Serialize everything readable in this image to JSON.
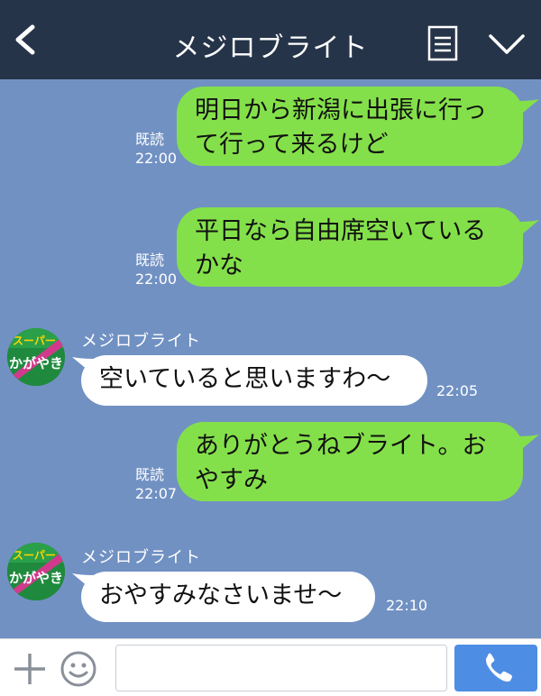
{
  "header": {
    "title": "メジロブライト"
  },
  "messages": [
    {
      "dir": "out",
      "lines": [
        "明日から新潟に出張に行っ",
        "て行って来るけど"
      ],
      "read": "既読",
      "time": "22:00"
    },
    {
      "dir": "out",
      "lines": [
        "平日なら自由席空いている",
        "かな"
      ],
      "read": "既読",
      "time": "22:00"
    },
    {
      "dir": "in",
      "sender": "メジロブライト",
      "lines": [
        "空いていると思いますわ〜"
      ],
      "time": "22:05"
    },
    {
      "dir": "out",
      "lines": [
        "ありがとうねブライト。お",
        "やすみ"
      ],
      "read": "既読",
      "time": "22:07"
    },
    {
      "dir": "in",
      "sender": "メジロブライト",
      "lines": [
        "おやすみなさいませ〜"
      ],
      "time": "22:10"
    }
  ],
  "avatar": {
    "logo_text": "スーパー",
    "name_text": "かがやき"
  },
  "input": {
    "placeholder": ""
  },
  "colors": {
    "header": "#263449",
    "chat_bg": "#7191c3",
    "out_bubble": "#84e04a",
    "in_bubble": "#ffffff",
    "call_button": "#4e8de4"
  }
}
